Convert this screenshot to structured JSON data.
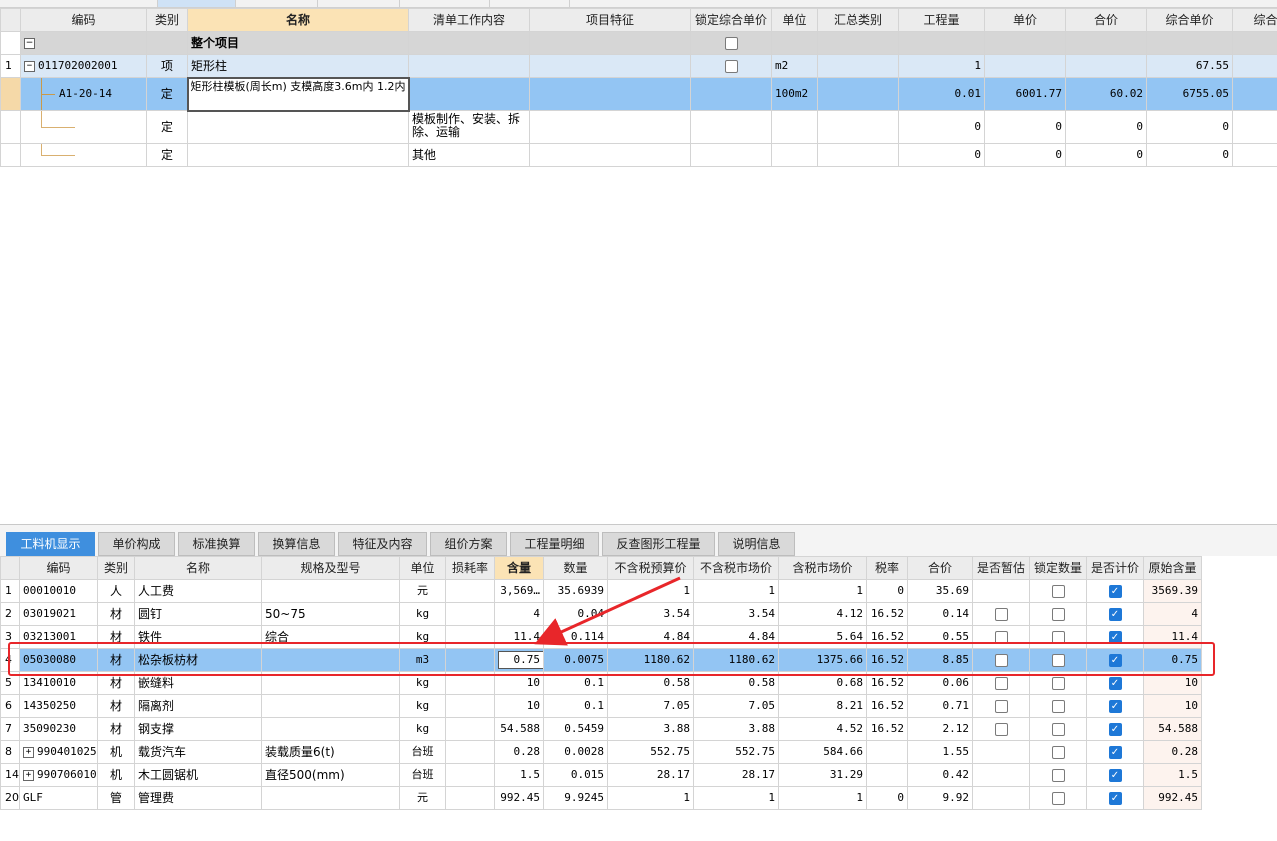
{
  "upper": {
    "headers": [
      "编码",
      "类别",
      "名称",
      "清单工作内容",
      "项目特征",
      "锁定综合单价",
      "单位",
      "汇总类别",
      "工程量",
      "单价",
      "合价",
      "综合单价",
      "综合单"
    ],
    "rows": [
      {
        "rn": "",
        "code": "整个项目",
        "type": "",
        "name": "",
        "content": "",
        "feature": "",
        "lock": true,
        "unit": "",
        "summary": "",
        "qty": "",
        "price": "",
        "total": "",
        "unitprice": ""
      },
      {
        "rn": "1",
        "code": "011702002001",
        "type": "项",
        "name": "矩形柱",
        "content": "",
        "feature": "",
        "lock": true,
        "unit": "m2",
        "summary": "",
        "qty": "1",
        "price": "",
        "total": "",
        "unitprice": "67.55"
      },
      {
        "rn": "",
        "code": "A1-20-14",
        "type": "定",
        "name": "矩形柱模板(周长m) 支模高度3.6m内 1.2内",
        "content": "",
        "feature": "",
        "lock": false,
        "unit": "100m2",
        "summary": "",
        "qty": "0.01",
        "price": "6001.77",
        "total": "60.02",
        "unitprice": "6755.05"
      },
      {
        "rn": "",
        "code": "",
        "type": "定",
        "name": "",
        "content": "模板制作、安装、拆除、运输",
        "feature": "",
        "lock": false,
        "unit": "",
        "summary": "",
        "qty": "0",
        "price": "0",
        "total": "0",
        "unitprice": "0"
      },
      {
        "rn": "",
        "code": "",
        "type": "定",
        "name": "",
        "content": "其他",
        "feature": "",
        "lock": false,
        "unit": "",
        "summary": "",
        "qty": "0",
        "price": "0",
        "total": "0",
        "unitprice": "0"
      }
    ]
  },
  "tabs": [
    "工料机显示",
    "单价构成",
    "标准换算",
    "换算信息",
    "特征及内容",
    "组价方案",
    "工程量明细",
    "反查图形工程量",
    "说明信息"
  ],
  "lower": {
    "headers": [
      "编码",
      "类别",
      "名称",
      "规格及型号",
      "单位",
      "损耗率",
      "含量",
      "数量",
      "不含税预算价",
      "不含税市场价",
      "含税市场价",
      "税率",
      "合价",
      "是否暂估",
      "锁定数量",
      "是否计价",
      "原始含量"
    ],
    "rows": [
      {
        "rn": "1",
        "code": "00010010",
        "type": "人",
        "name": "人工费",
        "spec": "",
        "unit": "元",
        "loss": "",
        "content": "3,569…",
        "qty": "35.6939",
        "p1": "1",
        "p2": "1",
        "p3": "1",
        "tax": "0",
        "total": "35.69",
        "est": false,
        "lockq": false,
        "priced": true,
        "orig": "3569.39",
        "plus": false
      },
      {
        "rn": "2",
        "code": "03019021",
        "type": "材",
        "name": "圆钉",
        "spec": "50~75",
        "unit": "kg",
        "loss": "",
        "content": "4",
        "qty": "0.04",
        "p1": "3.54",
        "p2": "3.54",
        "p3": "4.12",
        "tax": "16.52",
        "total": "0.14",
        "est": true,
        "lockq": true,
        "priced": true,
        "orig": "4",
        "plus": false
      },
      {
        "rn": "3",
        "code": "03213001",
        "type": "材",
        "name": "铁件",
        "spec": "综合",
        "unit": "kg",
        "loss": "",
        "content": "11.4",
        "qty": "0.114",
        "p1": "4.84",
        "p2": "4.84",
        "p3": "5.64",
        "tax": "16.52",
        "total": "0.55",
        "est": true,
        "lockq": true,
        "priced": true,
        "orig": "11.4",
        "plus": false
      },
      {
        "rn": "4",
        "code": "05030080",
        "type": "材",
        "name": "松杂板枋材",
        "spec": "",
        "unit": "m3",
        "loss": "",
        "content": "0.75",
        "qty": "0.0075",
        "p1": "1180.62",
        "p2": "1180.62",
        "p3": "1375.66",
        "tax": "16.52",
        "total": "8.85",
        "est": true,
        "lockq": true,
        "priced": true,
        "orig": "0.75",
        "plus": false
      },
      {
        "rn": "5",
        "code": "13410010",
        "type": "材",
        "name": "嵌缝料",
        "spec": "",
        "unit": "kg",
        "loss": "",
        "content": "10",
        "qty": "0.1",
        "p1": "0.58",
        "p2": "0.58",
        "p3": "0.68",
        "tax": "16.52",
        "total": "0.06",
        "est": true,
        "lockq": true,
        "priced": true,
        "orig": "10",
        "plus": false
      },
      {
        "rn": "6",
        "code": "14350250",
        "type": "材",
        "name": "隔离剂",
        "spec": "",
        "unit": "kg",
        "loss": "",
        "content": "10",
        "qty": "0.1",
        "p1": "7.05",
        "p2": "7.05",
        "p3": "8.21",
        "tax": "16.52",
        "total": "0.71",
        "est": true,
        "lockq": true,
        "priced": true,
        "orig": "10",
        "plus": false
      },
      {
        "rn": "7",
        "code": "35090230",
        "type": "材",
        "name": "钢支撑",
        "spec": "",
        "unit": "kg",
        "loss": "",
        "content": "54.588",
        "qty": "0.5459",
        "p1": "3.88",
        "p2": "3.88",
        "p3": "4.52",
        "tax": "16.52",
        "total": "2.12",
        "est": true,
        "lockq": true,
        "priced": true,
        "orig": "54.588",
        "plus": false
      },
      {
        "rn": "8",
        "code": "990401025",
        "type": "机",
        "name": "载货汽车",
        "spec": "装载质量6(t)",
        "unit": "台班",
        "loss": "",
        "content": "0.28",
        "qty": "0.0028",
        "p1": "552.75",
        "p2": "552.75",
        "p3": "584.66",
        "tax": "",
        "total": "1.55",
        "est": false,
        "lockq": true,
        "priced": true,
        "orig": "0.28",
        "plus": true
      },
      {
        "rn": "14",
        "code": "990706010",
        "type": "机",
        "name": "木工圆锯机",
        "spec": "直径500(mm)",
        "unit": "台班",
        "loss": "",
        "content": "1.5",
        "qty": "0.015",
        "p1": "28.17",
        "p2": "28.17",
        "p3": "31.29",
        "tax": "",
        "total": "0.42",
        "est": false,
        "lockq": true,
        "priced": true,
        "orig": "1.5",
        "plus": true
      },
      {
        "rn": "20",
        "code": "GLF",
        "type": "管",
        "name": "管理费",
        "spec": "",
        "unit": "元",
        "loss": "",
        "content": "992.45",
        "qty": "9.9245",
        "p1": "1",
        "p2": "1",
        "p3": "1",
        "tax": "0",
        "total": "9.92",
        "est": false,
        "lockq": true,
        "priced": true,
        "orig": "992.45",
        "plus": false
      }
    ]
  },
  "colors": {
    "selected_row": "#93c5f3",
    "item_row": "#dae8f6",
    "tab_active": "#3f8fde",
    "annotation": "#e8262a"
  }
}
